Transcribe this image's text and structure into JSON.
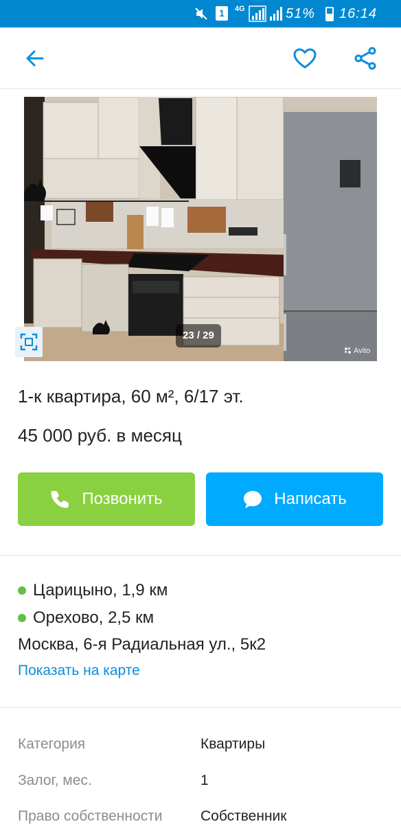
{
  "status_bar": {
    "network": "4G",
    "sim": "1",
    "battery_percent": "51%",
    "battery_level": 0.51,
    "time": "16:14",
    "icons": [
      "mute-icon",
      "sim-icon",
      "signal-icon",
      "battery-icon"
    ]
  },
  "app_bar": {
    "icons": [
      "back-arrow-icon",
      "heart-icon",
      "share-icon"
    ],
    "accent_color": "#0c8dd8"
  },
  "gallery": {
    "counter": "23 / 29",
    "watermark": "Avito",
    "icons": [
      "expand-icon"
    ]
  },
  "listing": {
    "title": "1-к квартира, 60 м², 6/17 эт.",
    "price": "45 000 руб. в месяц"
  },
  "actions": {
    "call_label": "Позвонить",
    "write_label": "Написать",
    "call_color": "#8ad141",
    "write_color": "#00aaff",
    "icons": [
      "phone-icon",
      "chat-bubble-icon"
    ]
  },
  "location": {
    "metro": [
      {
        "station": "Царицыно, 1,9 км",
        "color": "#61be48"
      },
      {
        "station": "Орехово, 2,5 км",
        "color": "#61be48"
      }
    ],
    "address": "Москва, 6-я Радиальная ул., 5к2",
    "map_link": "Показать на карте"
  },
  "params": [
    {
      "label": "Категория",
      "value": "Квартиры"
    },
    {
      "label": "Залог, мес.",
      "value": "1"
    },
    {
      "label": "Право собственности",
      "value": "Собственник"
    }
  ]
}
